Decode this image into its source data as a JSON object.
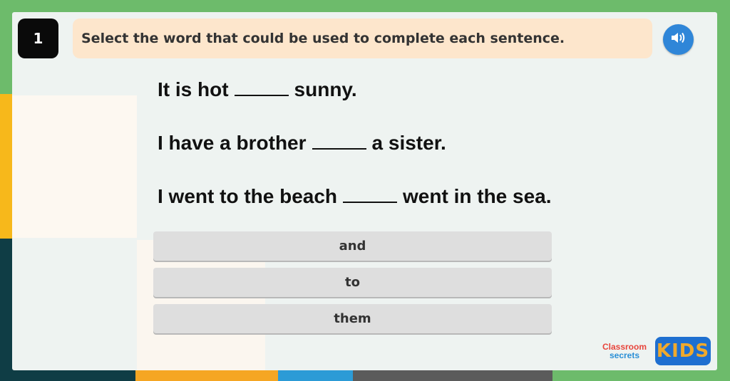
{
  "question": {
    "number": "1",
    "prompt": "Select the word that could be used to complete each sentence."
  },
  "audio_icon": "speaker-icon",
  "sentences": [
    {
      "before": "It is hot",
      "after": "sunny."
    },
    {
      "before": "I have a brother",
      "after": "a sister."
    },
    {
      "before": "I went to the beach",
      "after": "went in the sea."
    }
  ],
  "options": [
    "and",
    "to",
    "them"
  ],
  "logo": {
    "line1": "Classroom",
    "line2": "secrets",
    "badge": "KIDS"
  },
  "colors": {
    "background": "#6dbb6b",
    "prompt_bg": "#fde6cc",
    "audio_button": "#2f86d8",
    "option_bg": "#dedede"
  }
}
